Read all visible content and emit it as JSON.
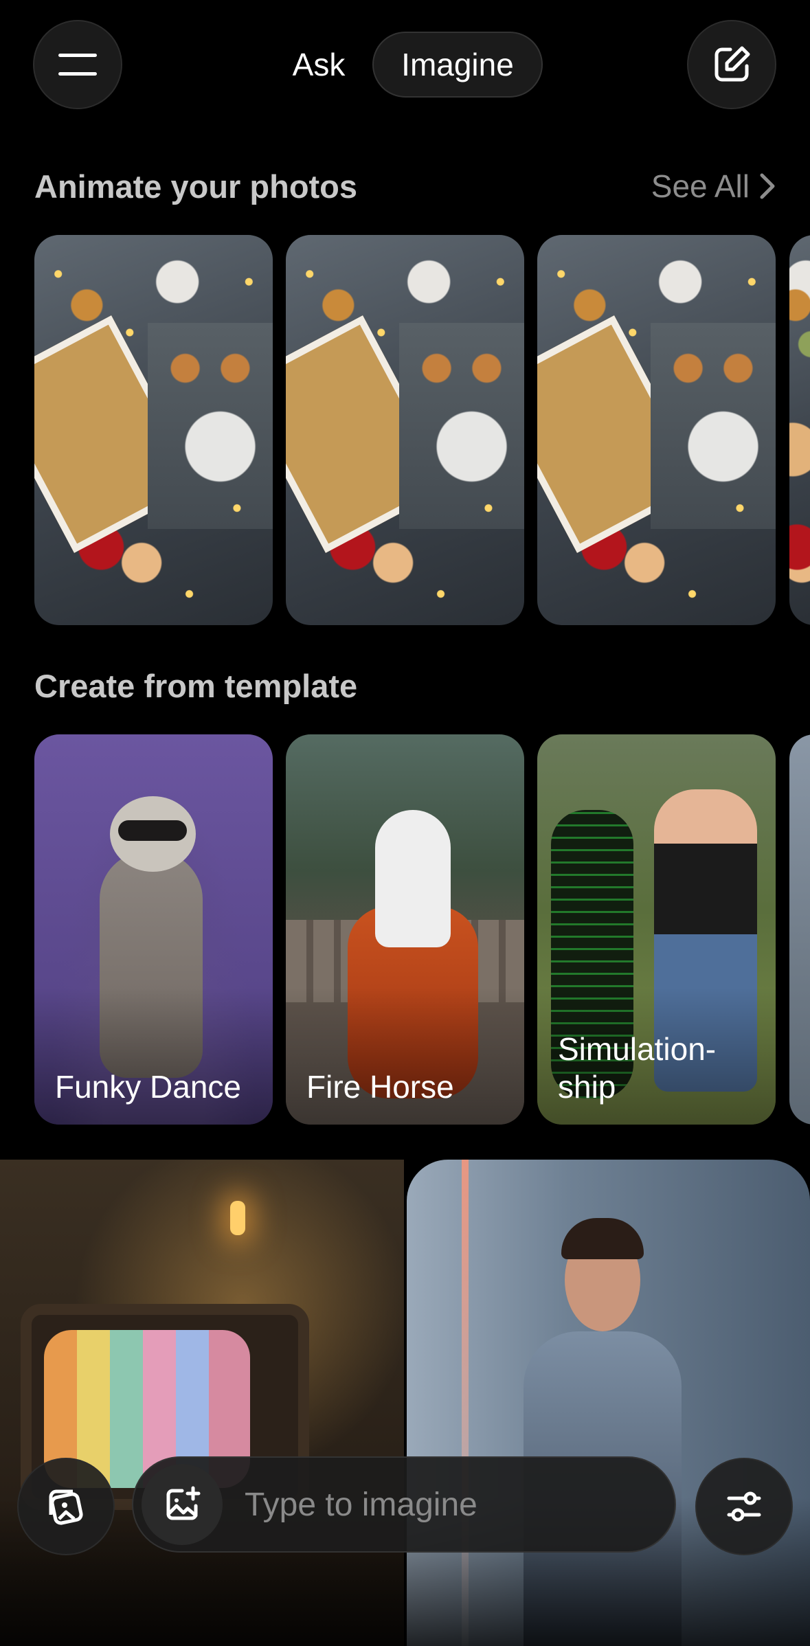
{
  "header": {
    "ask_label": "Ask",
    "imagine_label": "Imagine"
  },
  "sections": {
    "animate": {
      "title": "Animate your photos",
      "see_all": "See All"
    },
    "template": {
      "title": "Create from template"
    }
  },
  "templates": [
    {
      "label": "Funky Dance"
    },
    {
      "label": "Fire Horse"
    },
    {
      "label": "Simulation-\nship"
    }
  ],
  "composer": {
    "placeholder": "Type to imagine"
  },
  "icons": {
    "menu": "menu-icon",
    "new_chat": "edit-icon",
    "gallery": "gallery-icon",
    "add_image": "add-image-icon",
    "settings": "sliders-icon",
    "see_all": "chevron-right-icon"
  }
}
